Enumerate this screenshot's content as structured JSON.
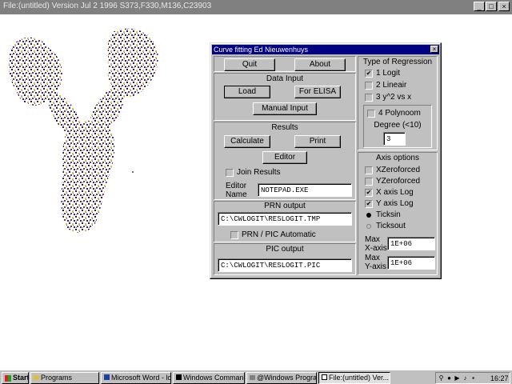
{
  "window": {
    "title": "File:(untitled) Version Jul  2 1996  S373,F330,M136,C23903",
    "min_label": "_",
    "max_label": "□",
    "close_label": "×"
  },
  "dialog": {
    "title": "Curve fitting Ed Nieuwenhuys",
    "close_label": "×",
    "quit_label": "Quit",
    "about_label": "About",
    "data_input": {
      "heading": "Data Input",
      "load_label": "Load",
      "elisa_label": "For ELISA",
      "manual_label": "Manual Input"
    },
    "results": {
      "heading": "Results",
      "calculate_label": "Calculate",
      "print_label": "Print",
      "editor_label": "Editor",
      "join_label": "Join Results",
      "editor_name_label_line1": "Editor",
      "editor_name_label_line2": "Name",
      "editor_name_value": "NOTEPAD.EXE"
    },
    "prn": {
      "heading": "PRN output",
      "path": "C:\\CWLOGIT\\RESLOGIT.TMP",
      "auto_label": "PRN / PIC Automatic"
    },
    "pic": {
      "heading": "PIC output",
      "path": "C:\\CWLOGIT\\RESLOGIT.PIC"
    },
    "regression": {
      "heading": "Type of Regression",
      "logit": "1 Logit",
      "lineair": "2 Lineair",
      "y2": "3 y^2 vs x",
      "polynoom": "4 Polynoom",
      "degree_label": "Degree (<10)",
      "degree_value": "3",
      "logit_checked": "✔"
    },
    "axis": {
      "heading": "Axis options",
      "xzero": "XZeroforced",
      "yzero": "YZeroforced",
      "xlog": "X axis Log",
      "ylog": "Y axis Log",
      "ticksin": "Ticksin",
      "ticksout": "Ticksout",
      "xlog_checked": "✔",
      "ylog_checked": "✔",
      "maxx_label_line1": "Max",
      "maxx_label_line2": "X-axis",
      "maxx_value": "1E+06",
      "maxy_label_line1": "Max",
      "maxy_label_line2": "Y-axis",
      "maxy_value": "1E+06"
    }
  },
  "taskbar": {
    "start_label": "Start",
    "items": [
      "Programs",
      "Microsoft Word - logit...",
      "Windows Command...",
      "@Windows Programs",
      "File:(untitled) Ver..."
    ],
    "clock": "16:27"
  }
}
